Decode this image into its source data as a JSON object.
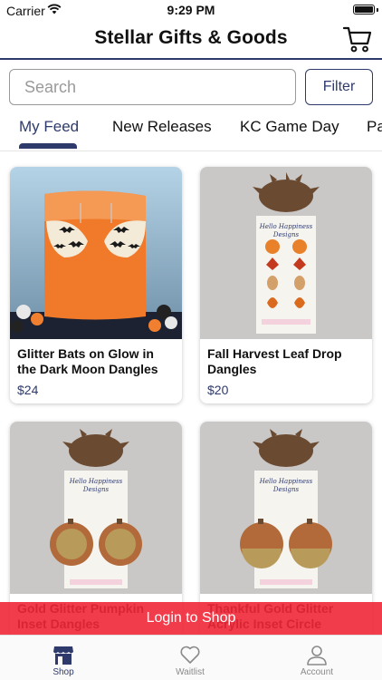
{
  "status_bar": {
    "carrier": "Carrier",
    "time": "9:29 PM"
  },
  "nav": {
    "title": "Stellar Gifts & Goods",
    "cart_icon": "cart-icon"
  },
  "search": {
    "placeholder": "Search",
    "value": ""
  },
  "filter": {
    "label": "Filter"
  },
  "tabs": [
    {
      "label": "My Feed",
      "active": true
    },
    {
      "label": "New Releases",
      "active": false
    },
    {
      "label": "KC Game Day",
      "active": false
    },
    {
      "label": "Pa",
      "active": false
    }
  ],
  "products": [
    {
      "title": "Glitter Bats on Glow in the Dark Moon Dangles",
      "price": "$24"
    },
    {
      "title": "Fall Harvest Leaf Drop Dangles",
      "price": "$20"
    },
    {
      "title": "Gold Glitter Pumpkin Inset Dangles",
      "price": ""
    },
    {
      "title": "Thankful Gold Glitter Acrylic Inset Circle",
      "price": ""
    }
  ],
  "login_banner": {
    "label": "Login to Shop"
  },
  "tabbar": [
    {
      "label": "Shop",
      "icon": "shop-icon",
      "active": true
    },
    {
      "label": "Waitlist",
      "icon": "heart-icon",
      "active": false
    },
    {
      "label": "Account",
      "icon": "person-icon",
      "active": false
    }
  ],
  "colors": {
    "primary": "#2e3a6b",
    "banner": "#f02837",
    "background": "#ffffff"
  }
}
